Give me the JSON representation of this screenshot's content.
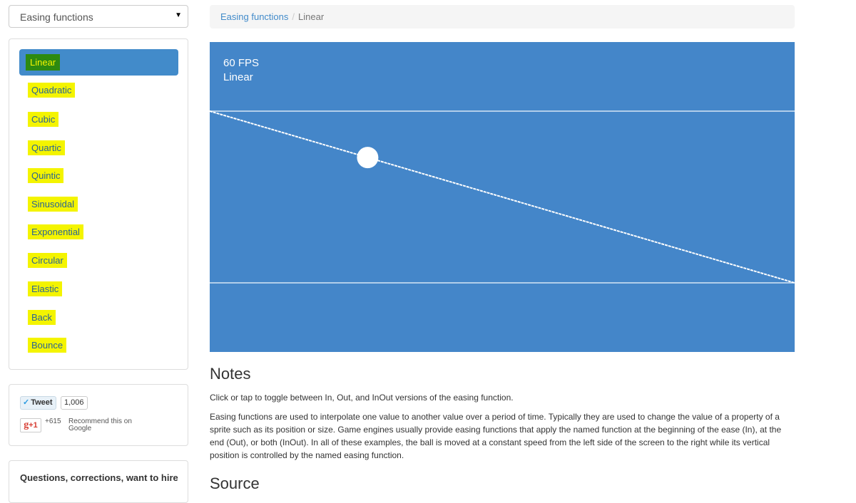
{
  "sidebar": {
    "select_value": "Easing functions",
    "nav": [
      {
        "label": "Linear",
        "active": true
      },
      {
        "label": "Quadratic"
      },
      {
        "label": "Cubic"
      },
      {
        "label": "Quartic"
      },
      {
        "label": "Quintic"
      },
      {
        "label": "Sinusoidal"
      },
      {
        "label": "Exponential"
      },
      {
        "label": "Circular"
      },
      {
        "label": "Elastic"
      },
      {
        "label": "Back"
      },
      {
        "label": "Bounce"
      }
    ],
    "social": {
      "tweet_label": "Tweet",
      "tweet_count": "1,006",
      "gplus_label": "+1",
      "gplus_count": "+615",
      "gplus_text": "Recommend this on Google"
    },
    "questions_title": "Questions, corrections, want to hire"
  },
  "breadcrumb": {
    "root": "Easing functions",
    "separator": "/",
    "current": "Linear"
  },
  "stage": {
    "fps": "60 FPS",
    "function_name": "Linear",
    "background": "#4486c9",
    "progress": 0.27
  },
  "notes": {
    "heading": "Notes",
    "toggle_text": "Click or tap to toggle between In, Out, and InOut versions of the easing function.",
    "description": "Easing functions are used to interpolate one value to another value over a period of time. Typically they are used to change the value of a property of a sprite such as its position or size. Game engines usually provide easing functions that apply the named function at the beginning of the ease (In), at the end (Out), or both (InOut). In all of these examples, the ball is moved at a constant speed from the left side of the screen to the right while its vertical position is controlled by the named easing function."
  },
  "source_heading": "Source"
}
